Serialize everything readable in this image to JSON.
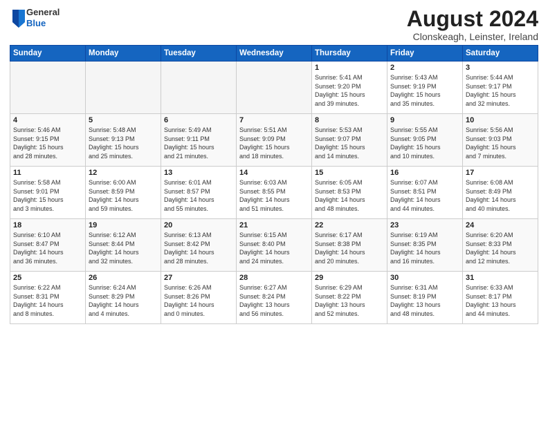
{
  "header": {
    "logo_general": "General",
    "logo_blue": "Blue",
    "month_year": "August 2024",
    "location": "Clonskeagh, Leinster, Ireland"
  },
  "days_of_week": [
    "Sunday",
    "Monday",
    "Tuesday",
    "Wednesday",
    "Thursday",
    "Friday",
    "Saturday"
  ],
  "weeks": [
    [
      {
        "day": "",
        "info": ""
      },
      {
        "day": "",
        "info": ""
      },
      {
        "day": "",
        "info": ""
      },
      {
        "day": "",
        "info": ""
      },
      {
        "day": "1",
        "info": "Sunrise: 5:41 AM\nSunset: 9:20 PM\nDaylight: 15 hours\nand 39 minutes."
      },
      {
        "day": "2",
        "info": "Sunrise: 5:43 AM\nSunset: 9:19 PM\nDaylight: 15 hours\nand 35 minutes."
      },
      {
        "day": "3",
        "info": "Sunrise: 5:44 AM\nSunset: 9:17 PM\nDaylight: 15 hours\nand 32 minutes."
      }
    ],
    [
      {
        "day": "4",
        "info": "Sunrise: 5:46 AM\nSunset: 9:15 PM\nDaylight: 15 hours\nand 28 minutes."
      },
      {
        "day": "5",
        "info": "Sunrise: 5:48 AM\nSunset: 9:13 PM\nDaylight: 15 hours\nand 25 minutes."
      },
      {
        "day": "6",
        "info": "Sunrise: 5:49 AM\nSunset: 9:11 PM\nDaylight: 15 hours\nand 21 minutes."
      },
      {
        "day": "7",
        "info": "Sunrise: 5:51 AM\nSunset: 9:09 PM\nDaylight: 15 hours\nand 18 minutes."
      },
      {
        "day": "8",
        "info": "Sunrise: 5:53 AM\nSunset: 9:07 PM\nDaylight: 15 hours\nand 14 minutes."
      },
      {
        "day": "9",
        "info": "Sunrise: 5:55 AM\nSunset: 9:05 PM\nDaylight: 15 hours\nand 10 minutes."
      },
      {
        "day": "10",
        "info": "Sunrise: 5:56 AM\nSunset: 9:03 PM\nDaylight: 15 hours\nand 7 minutes."
      }
    ],
    [
      {
        "day": "11",
        "info": "Sunrise: 5:58 AM\nSunset: 9:01 PM\nDaylight: 15 hours\nand 3 minutes."
      },
      {
        "day": "12",
        "info": "Sunrise: 6:00 AM\nSunset: 8:59 PM\nDaylight: 14 hours\nand 59 minutes."
      },
      {
        "day": "13",
        "info": "Sunrise: 6:01 AM\nSunset: 8:57 PM\nDaylight: 14 hours\nand 55 minutes."
      },
      {
        "day": "14",
        "info": "Sunrise: 6:03 AM\nSunset: 8:55 PM\nDaylight: 14 hours\nand 51 minutes."
      },
      {
        "day": "15",
        "info": "Sunrise: 6:05 AM\nSunset: 8:53 PM\nDaylight: 14 hours\nand 48 minutes."
      },
      {
        "day": "16",
        "info": "Sunrise: 6:07 AM\nSunset: 8:51 PM\nDaylight: 14 hours\nand 44 minutes."
      },
      {
        "day": "17",
        "info": "Sunrise: 6:08 AM\nSunset: 8:49 PM\nDaylight: 14 hours\nand 40 minutes."
      }
    ],
    [
      {
        "day": "18",
        "info": "Sunrise: 6:10 AM\nSunset: 8:47 PM\nDaylight: 14 hours\nand 36 minutes."
      },
      {
        "day": "19",
        "info": "Sunrise: 6:12 AM\nSunset: 8:44 PM\nDaylight: 14 hours\nand 32 minutes."
      },
      {
        "day": "20",
        "info": "Sunrise: 6:13 AM\nSunset: 8:42 PM\nDaylight: 14 hours\nand 28 minutes."
      },
      {
        "day": "21",
        "info": "Sunrise: 6:15 AM\nSunset: 8:40 PM\nDaylight: 14 hours\nand 24 minutes."
      },
      {
        "day": "22",
        "info": "Sunrise: 6:17 AM\nSunset: 8:38 PM\nDaylight: 14 hours\nand 20 minutes."
      },
      {
        "day": "23",
        "info": "Sunrise: 6:19 AM\nSunset: 8:35 PM\nDaylight: 14 hours\nand 16 minutes."
      },
      {
        "day": "24",
        "info": "Sunrise: 6:20 AM\nSunset: 8:33 PM\nDaylight: 14 hours\nand 12 minutes."
      }
    ],
    [
      {
        "day": "25",
        "info": "Sunrise: 6:22 AM\nSunset: 8:31 PM\nDaylight: 14 hours\nand 8 minutes."
      },
      {
        "day": "26",
        "info": "Sunrise: 6:24 AM\nSunset: 8:29 PM\nDaylight: 14 hours\nand 4 minutes."
      },
      {
        "day": "27",
        "info": "Sunrise: 6:26 AM\nSunset: 8:26 PM\nDaylight: 14 hours\nand 0 minutes."
      },
      {
        "day": "28",
        "info": "Sunrise: 6:27 AM\nSunset: 8:24 PM\nDaylight: 13 hours\nand 56 minutes."
      },
      {
        "day": "29",
        "info": "Sunrise: 6:29 AM\nSunset: 8:22 PM\nDaylight: 13 hours\nand 52 minutes."
      },
      {
        "day": "30",
        "info": "Sunrise: 6:31 AM\nSunset: 8:19 PM\nDaylight: 13 hours\nand 48 minutes."
      },
      {
        "day": "31",
        "info": "Sunrise: 6:33 AM\nSunset: 8:17 PM\nDaylight: 13 hours\nand 44 minutes."
      }
    ]
  ]
}
